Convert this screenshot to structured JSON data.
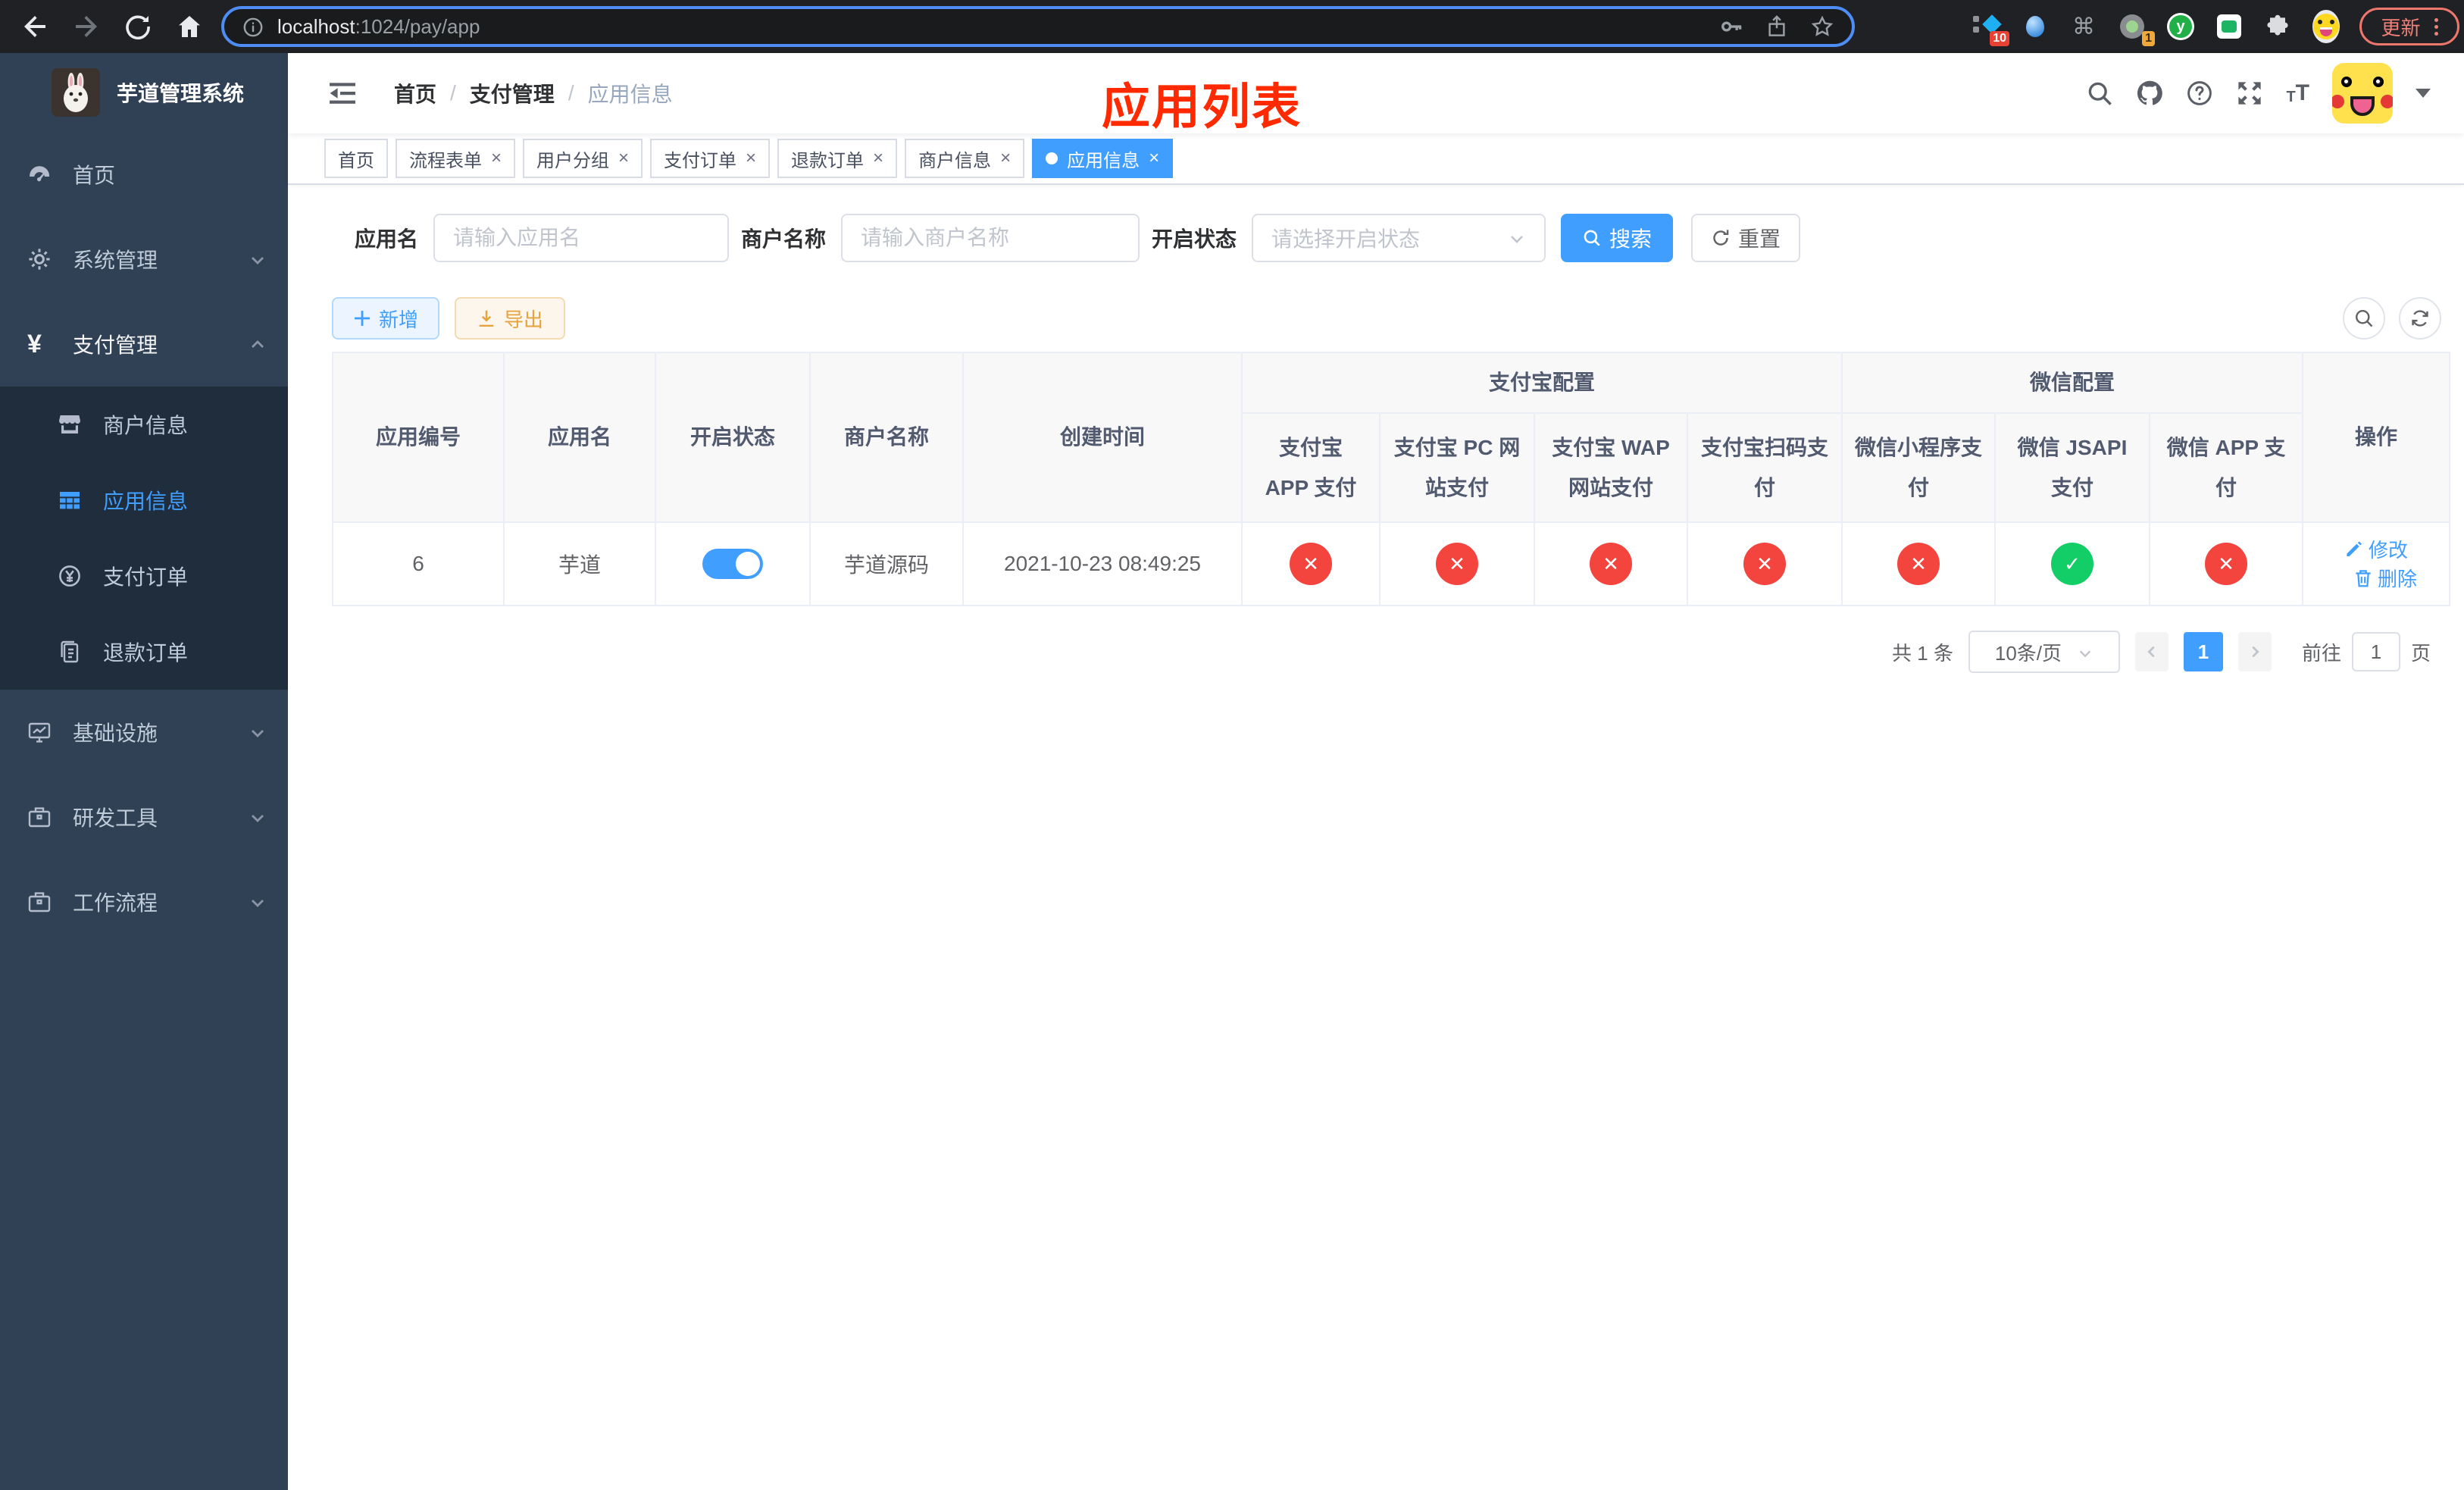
{
  "colors": {
    "accent": "#409eff",
    "success": "#13ce66",
    "danger": "#f4443e",
    "annotation_red": "#ff2a00",
    "warning": "#e6a23c"
  },
  "browser": {
    "url_host": "localhost",
    "url_path": ":1024/pay/app",
    "ext_badge_blue_diamond": "10",
    "ext_badge_gray_circle": "1",
    "update_label": "更新"
  },
  "sidebar": {
    "title": "芋道管理系统",
    "items": [
      {
        "label": "首页"
      },
      {
        "label": "系统管理"
      },
      {
        "label": "支付管理"
      },
      {
        "label": "商户信息"
      },
      {
        "label": "应用信息"
      },
      {
        "label": "支付订单"
      },
      {
        "label": "退款订单"
      },
      {
        "label": "基础设施"
      },
      {
        "label": "研发工具"
      },
      {
        "label": "工作流程"
      }
    ]
  },
  "header": {
    "breadcrumb": [
      "首页",
      "支付管理",
      "应用信息"
    ]
  },
  "annotation": {
    "title": "应用列表"
  },
  "tabs": [
    {
      "label": "首页"
    },
    {
      "label": "流程表单"
    },
    {
      "label": "用户分组"
    },
    {
      "label": "支付订单"
    },
    {
      "label": "退款订单"
    },
    {
      "label": "商户信息"
    },
    {
      "label": "应用信息"
    }
  ],
  "filters": {
    "app_name": {
      "label": "应用名",
      "placeholder": "请输入应用名"
    },
    "merchant": {
      "label": "商户名称",
      "placeholder": "请输入商户名称"
    },
    "status": {
      "label": "开启状态",
      "placeholder": "请选择开启状态"
    },
    "search_label": "搜索",
    "reset_label": "重置"
  },
  "toolbar": {
    "add_label": "新增",
    "export_label": "导出"
  },
  "table": {
    "simple_headers": [
      "应用编号",
      "应用名",
      "开启状态",
      "商户名称",
      "创建时间"
    ],
    "group_headers": [
      "支付宝配置",
      "微信配置"
    ],
    "sub_headers": [
      "支付宝 APP 支付",
      "支付宝 PC 网站支付",
      "支付宝 WAP 网站支付",
      "支付宝扫码支付",
      "微信小程序支付",
      "微信 JSAPI 支付",
      "微信 APP 支付"
    ],
    "action_header": "操作",
    "row": {
      "id": "6",
      "name": "芋道",
      "switch_on": true,
      "merchant": "芋道源码",
      "created": "2021-10-23 08:49:25",
      "statuses": [
        {
          "enabled": false,
          "symbol": "✕"
        },
        {
          "enabled": false,
          "symbol": "✕"
        },
        {
          "enabled": false,
          "symbol": "✕"
        },
        {
          "enabled": false,
          "symbol": "✕"
        },
        {
          "enabled": false,
          "symbol": "✕"
        },
        {
          "enabled": true,
          "symbol": "✓"
        },
        {
          "enabled": false,
          "symbol": "✕"
        }
      ],
      "actions": [
        {
          "label": "修改"
        },
        {
          "label": "删除"
        }
      ]
    }
  },
  "pagination": {
    "total_label": "共 1 条",
    "page_size_label": "10条/页",
    "current_page": "1",
    "goto_label": "前往",
    "goto_value": "1",
    "page_unit": "页"
  }
}
